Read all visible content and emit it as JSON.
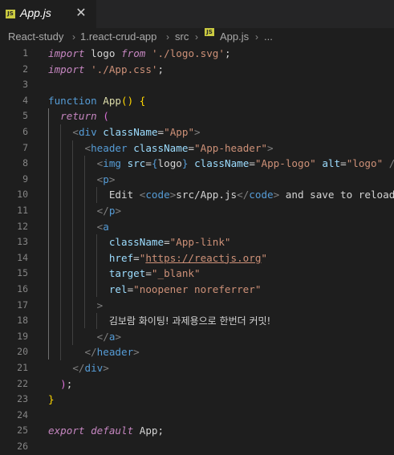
{
  "tab": {
    "filename": "App.js",
    "badge": "JS",
    "close": "✕"
  },
  "breadcrumb": {
    "items": [
      "React-study",
      "1.react-crud-app",
      "src",
      "App.js",
      "..."
    ],
    "separator": "›",
    "badge": "JS"
  },
  "editor": {
    "line_numbers": [
      "1",
      "2",
      "3",
      "4",
      "5",
      "6",
      "7",
      "8",
      "9",
      "10",
      "11",
      "12",
      "13",
      "14",
      "15",
      "16",
      "17",
      "18",
      "19",
      "20",
      "21",
      "22",
      "23",
      "24",
      "25",
      "26"
    ],
    "lines": [
      {
        "import": "import",
        "space1": " ",
        "name": "logo",
        "space2": " ",
        "from": "from",
        "space3": " ",
        "path": "'./logo.svg'",
        "semi": ";"
      },
      {
        "import": "import",
        "space1": " ",
        "path": "'./App.css'",
        "semi": ";"
      },
      {},
      {
        "function": "function",
        "space1": " ",
        "name": "App",
        "parens": "()",
        "space2": " ",
        "brace": "{"
      },
      {
        "indent": "  ",
        "return": "return",
        "space1": " ",
        "paren": "("
      },
      {
        "indent": "    ",
        "open": "<",
        "tag": "div",
        "space1": " ",
        "attr": "className",
        "eq": "=",
        "val": "\"App\"",
        "close": ">"
      },
      {
        "indent": "      ",
        "open": "<",
        "tag": "header",
        "space1": " ",
        "attr": "className",
        "eq": "=",
        "val": "\"App-header\"",
        "close": ">"
      },
      {
        "indent": "        ",
        "open": "<",
        "tag": "img",
        "space1": " ",
        "attr1": "src",
        "eq1": "=",
        "brace_open": "{",
        "expr": "logo",
        "brace_close": "}",
        "space2": " ",
        "attr2": "className",
        "eq2": "=",
        "val2": "\"App-logo\"",
        "space3": " ",
        "attr3": "alt",
        "eq3": "=",
        "val3": "\"logo\"",
        "space4": " ",
        "close": "/>"
      },
      {
        "indent": "        ",
        "open": "<",
        "tag": "p",
        "close": ">"
      },
      {
        "indent": "          ",
        "text1": "Edit ",
        "code_open_lt": "<",
        "code_tag": "code",
        "code_open_gt": ">",
        "text2": "src/App.js",
        "code_close_lt": "</",
        "code_tag2": "code",
        "code_close_gt": ">",
        "text3": " and save to reload."
      },
      {
        "indent": "        ",
        "open": "</",
        "tag": "p",
        "close": ">"
      },
      {
        "indent": "        ",
        "open": "<",
        "tag": "a"
      },
      {
        "indent": "          ",
        "attr": "className",
        "eq": "=",
        "val": "\"App-link\""
      },
      {
        "indent": "          ",
        "attr": "href",
        "eq": "=",
        "q1": "\"",
        "url": "https://reactjs.org",
        "q2": "\""
      },
      {
        "indent": "          ",
        "attr": "target",
        "eq": "=",
        "val": "\"_blank\""
      },
      {
        "indent": "          ",
        "attr": "rel",
        "eq": "=",
        "val": "\"noopener noreferrer\""
      },
      {
        "indent": "        ",
        "close": ">"
      },
      {
        "indent": "          ",
        "text": "김보람 화이팅! 과제용으로 한번더 커밋!"
      },
      {
        "indent": "        ",
        "open": "</",
        "tag": "a",
        "close": ">"
      },
      {
        "indent": "      ",
        "open": "</",
        "tag": "header",
        "close": ">"
      },
      {
        "indent": "    ",
        "open": "</",
        "tag": "div",
        "close": ">"
      },
      {
        "indent": "  ",
        "paren": ")",
        "semi": ";"
      },
      {
        "brace": "}"
      },
      {},
      {
        "export": "export",
        "space1": " ",
        "default": "default",
        "space2": " ",
        "name": "App",
        "semi": ";"
      },
      {}
    ]
  },
  "colors": {
    "background": "#1e1e1e",
    "tabbar": "#252526",
    "keyword_control": "#c586c0",
    "keyword": "#569cd6",
    "function": "#dcdcaa",
    "string": "#ce9178",
    "attribute": "#9cdcfe",
    "bracket_gold": "#ffd700",
    "bracket_orchid": "#da70d6",
    "line_number": "#858585"
  }
}
